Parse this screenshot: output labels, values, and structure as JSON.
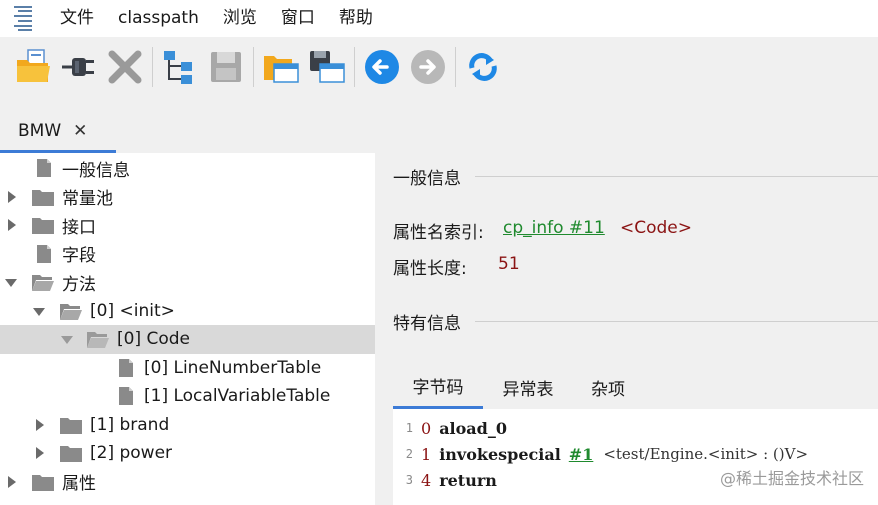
{
  "menubar": {
    "items": [
      {
        "label": "文件"
      },
      {
        "label": "classpath"
      },
      {
        "label": "浏览"
      },
      {
        "label": "窗口"
      },
      {
        "label": "帮助"
      }
    ]
  },
  "toolbar": {
    "buttons": [
      {
        "icon": "open-folder-icon"
      },
      {
        "icon": "plug-icon"
      },
      {
        "icon": "close-x-icon"
      },
      {
        "icon": "tree-hierarchy-icon"
      },
      {
        "icon": "save-icon"
      },
      {
        "icon": "open-window-icon"
      },
      {
        "icon": "save-window-icon"
      },
      {
        "icon": "back-arrow-icon"
      },
      {
        "icon": "forward-arrow-icon"
      },
      {
        "icon": "sync-icon"
      }
    ]
  },
  "tab": {
    "label": "BMW",
    "close": "✕"
  },
  "tree": {
    "items": [
      {
        "label": "一般信息"
      },
      {
        "label": "常量池"
      },
      {
        "label": "接口"
      },
      {
        "label": "字段"
      },
      {
        "label": "方法"
      },
      {
        "label": "[0] <init>"
      },
      {
        "label": "[0] Code"
      },
      {
        "label": "[0] LineNumberTable"
      },
      {
        "label": "[1] LocalVariableTable"
      },
      {
        "label": "[1] brand"
      },
      {
        "label": "[2] power"
      },
      {
        "label": "属性"
      }
    ]
  },
  "general": {
    "title": "一般信息",
    "name_index_label": "属性名索引:",
    "name_index_link": "cp_info #11",
    "name_index_tag": "<Code>",
    "length_label": "属性长度:",
    "length_value": "51"
  },
  "specific": {
    "title": "特有信息",
    "tabs": [
      {
        "label": "字节码"
      },
      {
        "label": "异常表"
      },
      {
        "label": "杂项"
      }
    ]
  },
  "bytecode": {
    "lines": [
      {
        "ln": "1",
        "pc": "0",
        "op": "aload_0",
        "ref": "",
        "comment": ""
      },
      {
        "ln": "2",
        "pc": "1",
        "op": "invokespecial",
        "ref": "#1",
        "comment": "<test/Engine.<init> : ()V>"
      },
      {
        "ln": "3",
        "pc": "4",
        "op": "return",
        "ref": "",
        "comment": ""
      }
    ]
  },
  "watermark": "@稀土掘金技术社区"
}
